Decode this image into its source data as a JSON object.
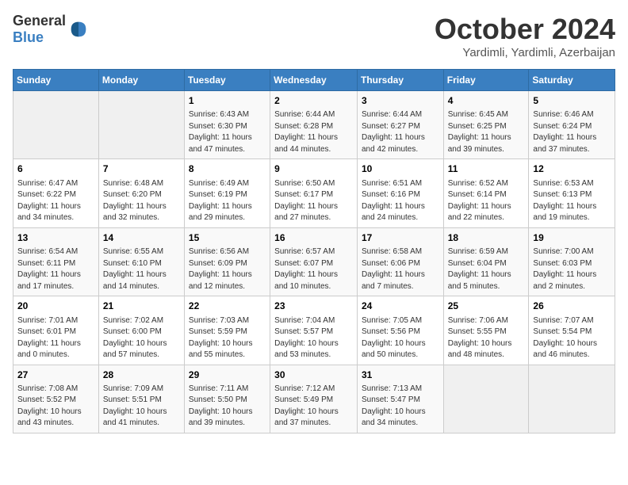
{
  "header": {
    "logo_general": "General",
    "logo_blue": "Blue",
    "month": "October 2024",
    "location": "Yardimli, Yardimli, Azerbaijan"
  },
  "columns": [
    "Sunday",
    "Monday",
    "Tuesday",
    "Wednesday",
    "Thursday",
    "Friday",
    "Saturday"
  ],
  "weeks": [
    [
      {
        "day": "",
        "info": ""
      },
      {
        "day": "",
        "info": ""
      },
      {
        "day": "1",
        "info": "Sunrise: 6:43 AM\nSunset: 6:30 PM\nDaylight: 11 hours and 47 minutes."
      },
      {
        "day": "2",
        "info": "Sunrise: 6:44 AM\nSunset: 6:28 PM\nDaylight: 11 hours and 44 minutes."
      },
      {
        "day": "3",
        "info": "Sunrise: 6:44 AM\nSunset: 6:27 PM\nDaylight: 11 hours and 42 minutes."
      },
      {
        "day": "4",
        "info": "Sunrise: 6:45 AM\nSunset: 6:25 PM\nDaylight: 11 hours and 39 minutes."
      },
      {
        "day": "5",
        "info": "Sunrise: 6:46 AM\nSunset: 6:24 PM\nDaylight: 11 hours and 37 minutes."
      }
    ],
    [
      {
        "day": "6",
        "info": "Sunrise: 6:47 AM\nSunset: 6:22 PM\nDaylight: 11 hours and 34 minutes."
      },
      {
        "day": "7",
        "info": "Sunrise: 6:48 AM\nSunset: 6:20 PM\nDaylight: 11 hours and 32 minutes."
      },
      {
        "day": "8",
        "info": "Sunrise: 6:49 AM\nSunset: 6:19 PM\nDaylight: 11 hours and 29 minutes."
      },
      {
        "day": "9",
        "info": "Sunrise: 6:50 AM\nSunset: 6:17 PM\nDaylight: 11 hours and 27 minutes."
      },
      {
        "day": "10",
        "info": "Sunrise: 6:51 AM\nSunset: 6:16 PM\nDaylight: 11 hours and 24 minutes."
      },
      {
        "day": "11",
        "info": "Sunrise: 6:52 AM\nSunset: 6:14 PM\nDaylight: 11 hours and 22 minutes."
      },
      {
        "day": "12",
        "info": "Sunrise: 6:53 AM\nSunset: 6:13 PM\nDaylight: 11 hours and 19 minutes."
      }
    ],
    [
      {
        "day": "13",
        "info": "Sunrise: 6:54 AM\nSunset: 6:11 PM\nDaylight: 11 hours and 17 minutes."
      },
      {
        "day": "14",
        "info": "Sunrise: 6:55 AM\nSunset: 6:10 PM\nDaylight: 11 hours and 14 minutes."
      },
      {
        "day": "15",
        "info": "Sunrise: 6:56 AM\nSunset: 6:09 PM\nDaylight: 11 hours and 12 minutes."
      },
      {
        "day": "16",
        "info": "Sunrise: 6:57 AM\nSunset: 6:07 PM\nDaylight: 11 hours and 10 minutes."
      },
      {
        "day": "17",
        "info": "Sunrise: 6:58 AM\nSunset: 6:06 PM\nDaylight: 11 hours and 7 minutes."
      },
      {
        "day": "18",
        "info": "Sunrise: 6:59 AM\nSunset: 6:04 PM\nDaylight: 11 hours and 5 minutes."
      },
      {
        "day": "19",
        "info": "Sunrise: 7:00 AM\nSunset: 6:03 PM\nDaylight: 11 hours and 2 minutes."
      }
    ],
    [
      {
        "day": "20",
        "info": "Sunrise: 7:01 AM\nSunset: 6:01 PM\nDaylight: 11 hours and 0 minutes."
      },
      {
        "day": "21",
        "info": "Sunrise: 7:02 AM\nSunset: 6:00 PM\nDaylight: 10 hours and 57 minutes."
      },
      {
        "day": "22",
        "info": "Sunrise: 7:03 AM\nSunset: 5:59 PM\nDaylight: 10 hours and 55 minutes."
      },
      {
        "day": "23",
        "info": "Sunrise: 7:04 AM\nSunset: 5:57 PM\nDaylight: 10 hours and 53 minutes."
      },
      {
        "day": "24",
        "info": "Sunrise: 7:05 AM\nSunset: 5:56 PM\nDaylight: 10 hours and 50 minutes."
      },
      {
        "day": "25",
        "info": "Sunrise: 7:06 AM\nSunset: 5:55 PM\nDaylight: 10 hours and 48 minutes."
      },
      {
        "day": "26",
        "info": "Sunrise: 7:07 AM\nSunset: 5:54 PM\nDaylight: 10 hours and 46 minutes."
      }
    ],
    [
      {
        "day": "27",
        "info": "Sunrise: 7:08 AM\nSunset: 5:52 PM\nDaylight: 10 hours and 43 minutes."
      },
      {
        "day": "28",
        "info": "Sunrise: 7:09 AM\nSunset: 5:51 PM\nDaylight: 10 hours and 41 minutes."
      },
      {
        "day": "29",
        "info": "Sunrise: 7:11 AM\nSunset: 5:50 PM\nDaylight: 10 hours and 39 minutes."
      },
      {
        "day": "30",
        "info": "Sunrise: 7:12 AM\nSunset: 5:49 PM\nDaylight: 10 hours and 37 minutes."
      },
      {
        "day": "31",
        "info": "Sunrise: 7:13 AM\nSunset: 5:47 PM\nDaylight: 10 hours and 34 minutes."
      },
      {
        "day": "",
        "info": ""
      },
      {
        "day": "",
        "info": ""
      }
    ]
  ]
}
